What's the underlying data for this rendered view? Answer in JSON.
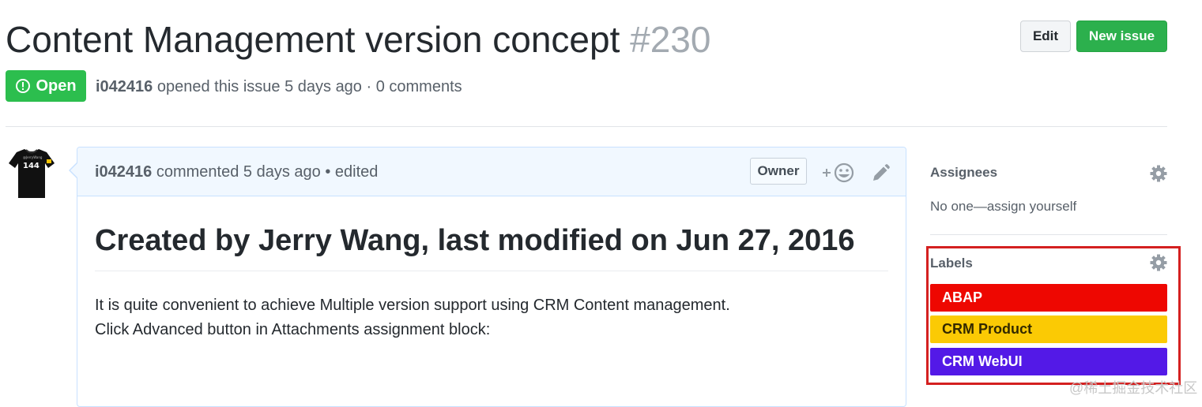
{
  "issue": {
    "title": "Content Management version concept",
    "number": "#230",
    "state": "Open",
    "author": "i042416",
    "opened_text": "opened this issue 5 days ago · 0 comments"
  },
  "header_actions": {
    "edit_label": "Edit",
    "new_issue_label": "New issue"
  },
  "comment": {
    "author": "i042416",
    "meta": "commented 5 days ago • edited",
    "owner_badge": "Owner",
    "avatar_text": "144",
    "heading": "Created by Jerry Wang, last modified on Jun 27, 2016",
    "line1": "It is quite convenient to achieve Multiple version support using CRM Content management.",
    "line2": "Click Advanced button in Attachments assignment block:"
  },
  "sidebar": {
    "assignees_heading": "Assignees",
    "assignees_value": "No one—assign yourself",
    "labels_heading": "Labels",
    "labels": [
      {
        "name": "ABAP",
        "bg": "#ee0701",
        "fg": "#ffffff"
      },
      {
        "name": "CRM Product",
        "bg": "#fbca04",
        "fg": "#332900"
      },
      {
        "name": "CRM WebUI",
        "bg": "#5319e7",
        "fg": "#ffffff"
      }
    ]
  },
  "watermark": "@稀土掘金技术社区",
  "icons": [
    "alert-icon",
    "smiley-icon",
    "pencil-icon",
    "gear-icon"
  ]
}
